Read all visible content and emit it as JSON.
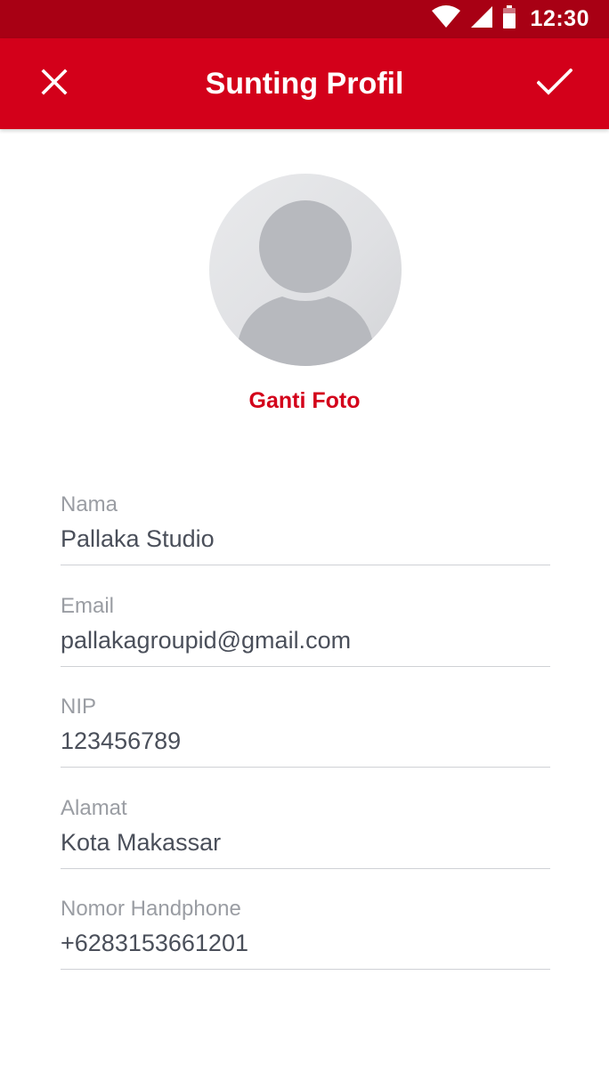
{
  "status_bar": {
    "time": "12:30",
    "icons": [
      "wifi-icon",
      "signal-icon",
      "battery-icon"
    ]
  },
  "app_bar": {
    "title": "Sunting Profil",
    "close_icon": "close-icon",
    "confirm_icon": "check-icon"
  },
  "avatar": {
    "icon": "default-avatar-icon",
    "change_photo_label": "Ganti Foto"
  },
  "form": {
    "fields": [
      {
        "label": "Nama",
        "value": "Pallaka Studio"
      },
      {
        "label": "Email",
        "value": "pallakagroupid@gmail.com"
      },
      {
        "label": "NIP",
        "value": "123456789"
      },
      {
        "label": "Alamat",
        "value": "Kota Makassar"
      },
      {
        "label": "Nomor Handphone",
        "value": "+6283153661201"
      }
    ]
  },
  "colors": {
    "status_bar": "#a80014",
    "app_bar": "#d3001a",
    "accent": "#d3001a",
    "label": "#9a9da3",
    "value": "#4a4f5a",
    "divider": "#cfd1d5"
  }
}
